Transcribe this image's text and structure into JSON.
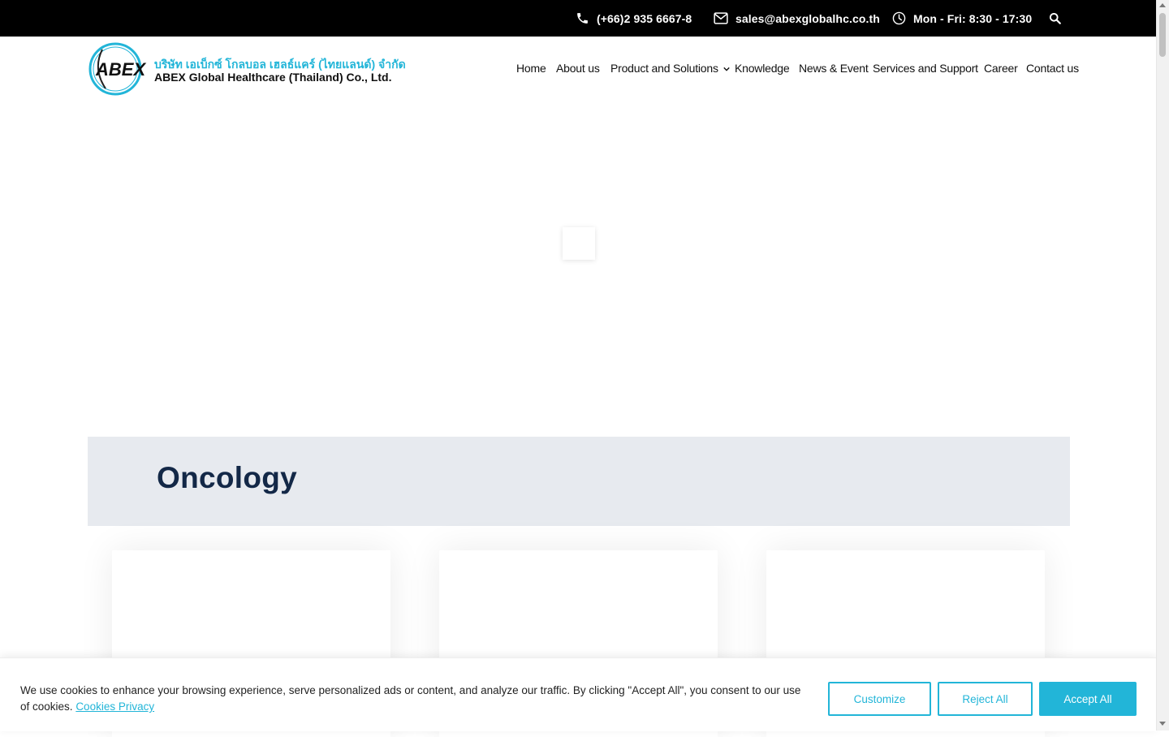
{
  "topbar": {
    "phone": "(+66)2 935 6667-8",
    "email": "sales@abexglobalhc.co.th",
    "hours": "Mon - Fri: 8:30 - 17:30"
  },
  "logo": {
    "mark": "ABEX",
    "thai_name": "บริษัท เอเบ็กซ์ โกลบอล เฮลธ์แคร์ (ไทยแลนด์) จำกัด",
    "english_name": "ABEX Global Healthcare (Thailand) Co., Ltd."
  },
  "nav": {
    "items": [
      "Home",
      "About us",
      "Product and Solutions",
      "Knowledge",
      "News & Event",
      "Services and Support",
      "Career",
      "Contact us"
    ]
  },
  "banner": {
    "title": "Oncology"
  },
  "cookie": {
    "message": "We use cookies to enhance your browsing experience, serve personalized ads or content, and analyze our traffic. By clicking \"Accept All\", you consent to our use of cookies.",
    "link": "Cookies Privacy",
    "customize": "Customize",
    "reject": "Reject All",
    "accept": "Accept All"
  },
  "colors": {
    "accent": "#22b5d8",
    "banner_bg": "#e7eaef",
    "title": "#132847",
    "topbar_bg": "#000000"
  },
  "icons": [
    "phone-icon",
    "mail-icon",
    "clock-icon",
    "search-icon",
    "chevron-down-icon"
  ]
}
